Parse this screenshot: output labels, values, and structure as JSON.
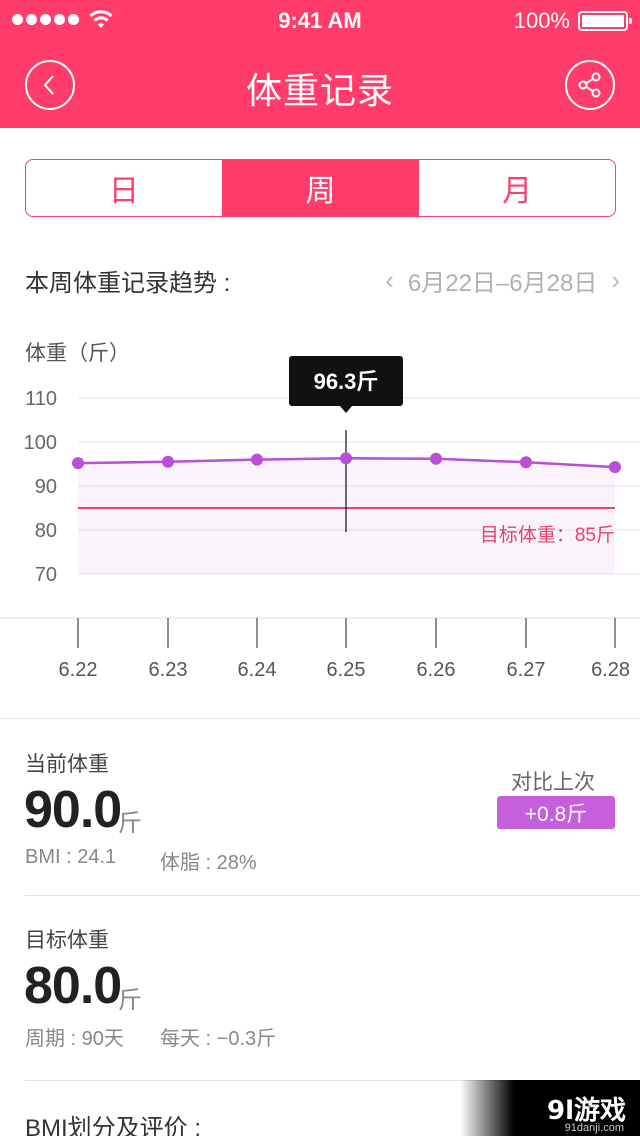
{
  "status_bar": {
    "time": "9:41 AM",
    "battery": "100%"
  },
  "header": {
    "title": "体重记录",
    "back_icon": "chevron-left-icon",
    "share_icon": "share-icon",
    "color": "#ff3c6a"
  },
  "tabs": [
    {
      "label": "日",
      "active": false
    },
    {
      "label": "周",
      "active": true
    },
    {
      "label": "月",
      "active": false
    }
  ],
  "trend": {
    "title": "本周体重记录趋势 :",
    "prev": "‹",
    "date_range": "6月22日–6月28日",
    "next": "›"
  },
  "chart_data": {
    "type": "line",
    "ylabel": "体重（斤）",
    "ylim": [
      70,
      110
    ],
    "yticks": [
      "110",
      "100",
      "90",
      "80",
      "70"
    ],
    "categories": [
      "6.22",
      "6.23",
      "6.24",
      "6.25",
      "6.26",
      "6.27",
      "6.28"
    ],
    "series": [
      {
        "values": [
          95.2,
          95.5,
          96.0,
          96.3,
          96.2,
          95.4,
          94.3
        ],
        "color": "#b84fd4"
      }
    ],
    "target": {
      "value": 85,
      "label": "目标体重：85斤",
      "color": "#e8416c"
    },
    "tooltip": {
      "index": 3,
      "text": "96.3斤"
    },
    "grid": true
  },
  "current": {
    "label": "当前体重",
    "value": "90.0",
    "unit": "斤",
    "bmi": "BMI : 24.1",
    "fat": "体脂 : 28%",
    "compare_label": "对比上次",
    "compare_value": "+0.8斤"
  },
  "goal": {
    "label": "目标体重",
    "value": "80.0",
    "unit": "斤",
    "period": "周期 : 90天",
    "daily": "每天 : −0.3斤"
  },
  "bmi_section": {
    "title": "BMI划分及评价 :"
  },
  "watermark": {
    "text": "9l游戏",
    "sub": "91danji.com"
  }
}
